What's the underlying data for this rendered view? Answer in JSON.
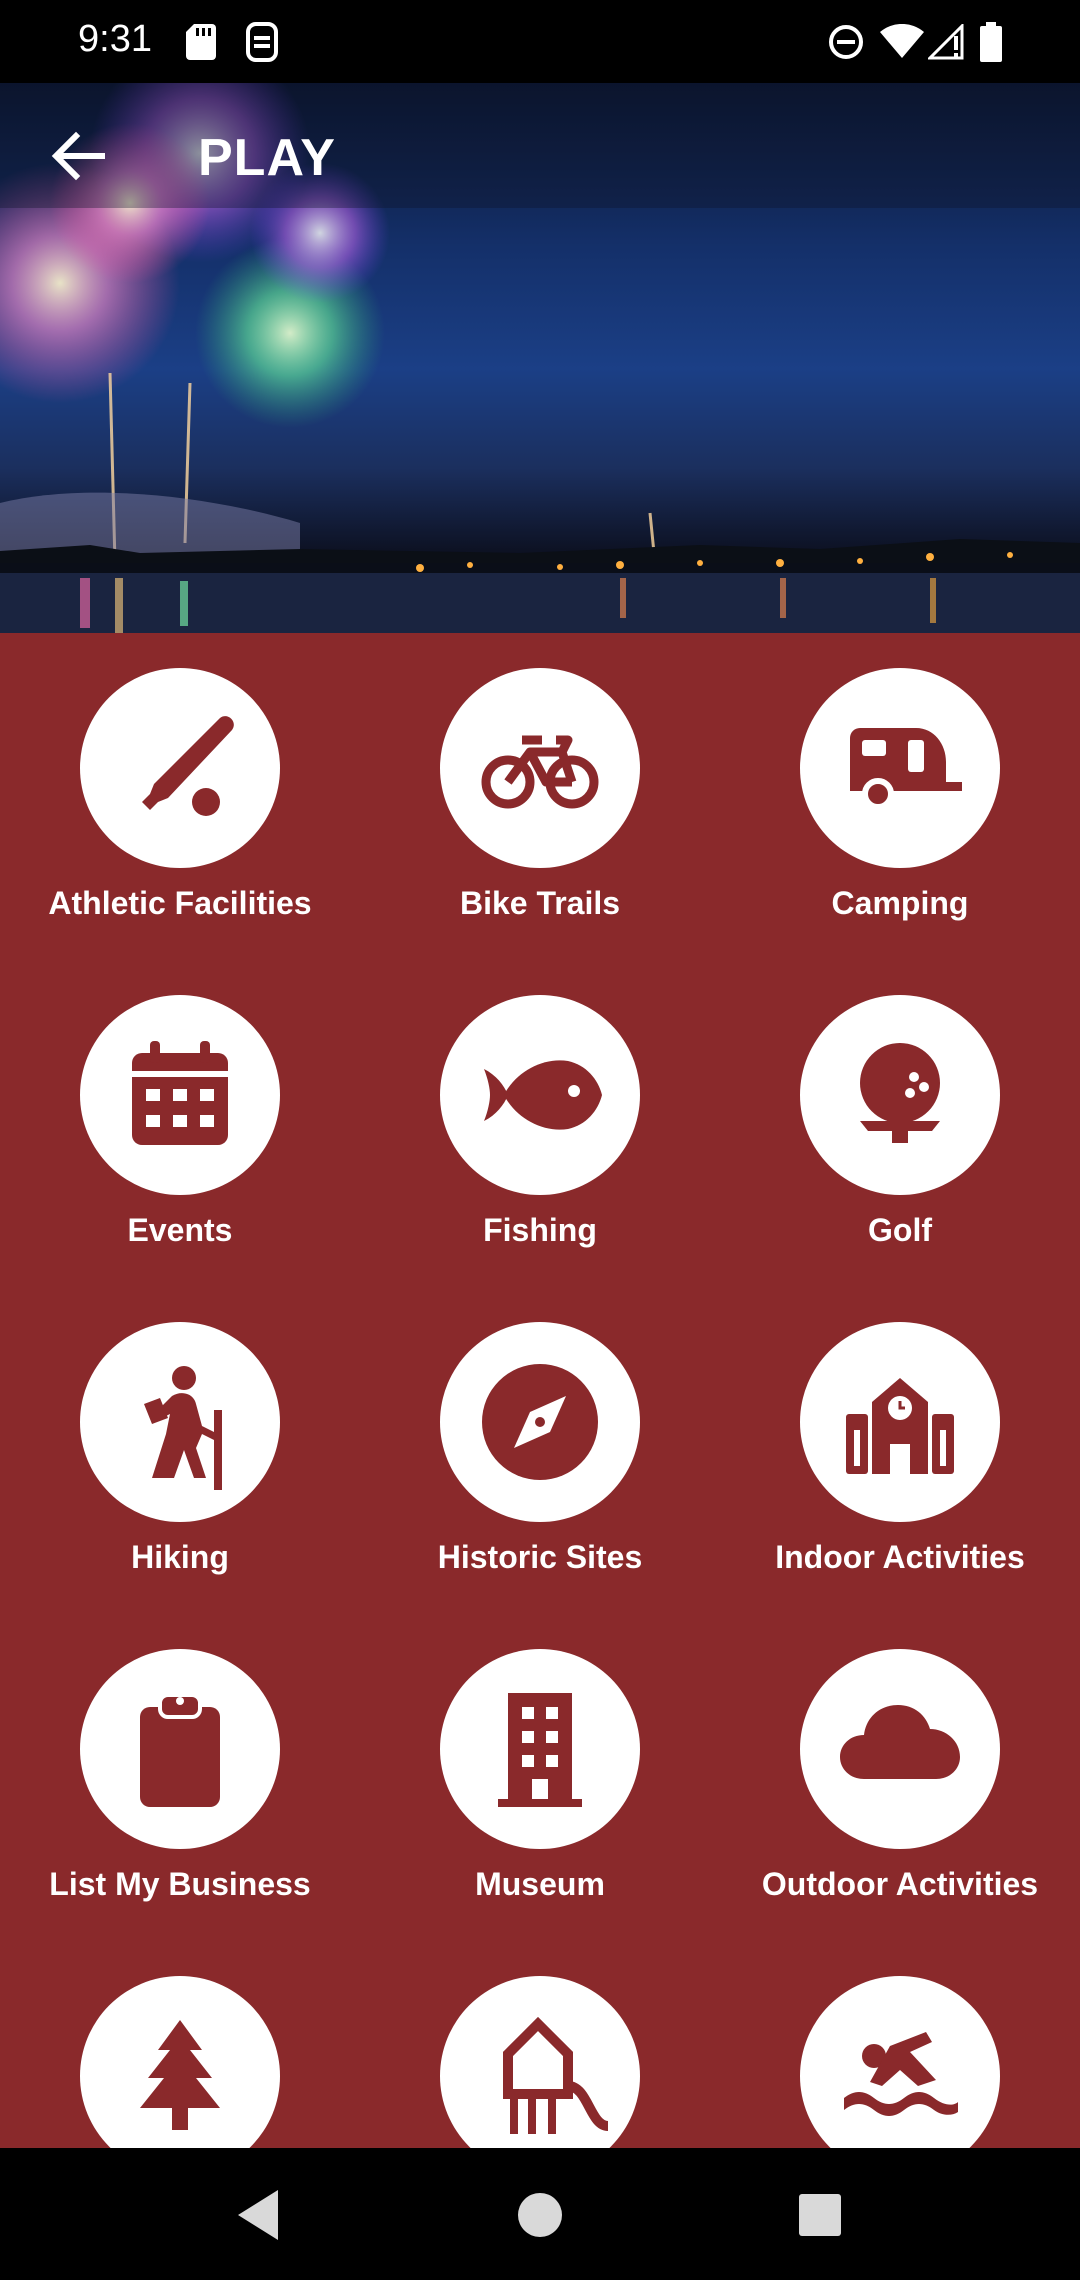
{
  "status_bar": {
    "time": "9:31",
    "left_icons": [
      "sd-card-icon",
      "sync-icon"
    ],
    "right_icons": [
      "do-not-disturb-icon",
      "wifi-icon",
      "signal-icon",
      "battery-icon"
    ]
  },
  "header": {
    "title": "PLAY",
    "back_icon": "arrow-left-icon"
  },
  "colors": {
    "background": "#8a292b",
    "icon_circle": "#ffffff",
    "icon_glyph": "#8a292b"
  },
  "categories": [
    {
      "label": "Athletic Facilities",
      "icon": "baseball-icon"
    },
    {
      "label": "Bike Trails",
      "icon": "bicycle-icon"
    },
    {
      "label": "Camping",
      "icon": "camper-icon"
    },
    {
      "label": "Events",
      "icon": "calendar-icon"
    },
    {
      "label": "Fishing",
      "icon": "fish-icon"
    },
    {
      "label": "Golf",
      "icon": "golf-ball-icon"
    },
    {
      "label": "Hiking",
      "icon": "hiker-icon"
    },
    {
      "label": "Historic Sites",
      "icon": "compass-icon"
    },
    {
      "label": "Indoor Activities",
      "icon": "school-icon"
    },
    {
      "label": "List My Business",
      "icon": "clipboard-icon"
    },
    {
      "label": "Museum",
      "icon": "building-icon"
    },
    {
      "label": "Outdoor Activities",
      "icon": "cloud-icon"
    },
    {
      "label": "",
      "icon": "pine-tree-icon"
    },
    {
      "label": "",
      "icon": "water-tower-icon"
    },
    {
      "label": "",
      "icon": "swimmer-icon"
    }
  ],
  "nav_bar": {
    "buttons": [
      "back-triangle-icon",
      "home-circle-icon",
      "recents-square-icon"
    ]
  }
}
